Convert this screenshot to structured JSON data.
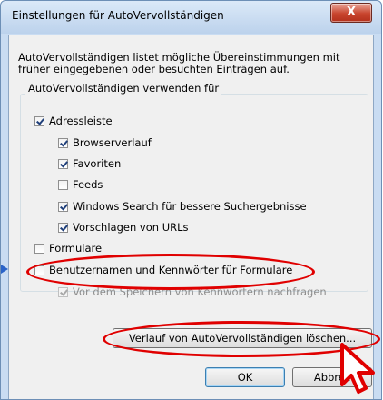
{
  "window": {
    "title": "Einstellungen für AutoVervollständigen",
    "close_label": "X"
  },
  "description": "AutoVervollständigen listet mögliche Übereinstimmungen mit früher eingegebenen oder besuchten Einträgen auf.",
  "group": {
    "legend": "AutoVervollständigen verwenden für"
  },
  "checkboxes": [
    {
      "label": "Adressleiste",
      "checked": true
    },
    {
      "label": "Browserverlauf",
      "checked": true
    },
    {
      "label": "Favoriten",
      "checked": true
    },
    {
      "label": "Feeds",
      "checked": false
    },
    {
      "label": "Windows Search für bessere Suchergebnisse",
      "checked": true
    },
    {
      "label": "Vorschlagen von URLs",
      "checked": true
    },
    {
      "label": "Formulare",
      "checked": false
    },
    {
      "label": "Benutzernamen und Kennwörter für Formulare",
      "checked": false
    },
    {
      "label": "Vor dem Speichern von Kennwörtern nachfragen",
      "checked": true,
      "disabled": true
    }
  ],
  "buttons": {
    "clear_history": "Verlauf von AutoVervollständigen löschen...",
    "ok": "OK",
    "cancel": "Abbrec"
  },
  "highlight_color": "#e00000"
}
